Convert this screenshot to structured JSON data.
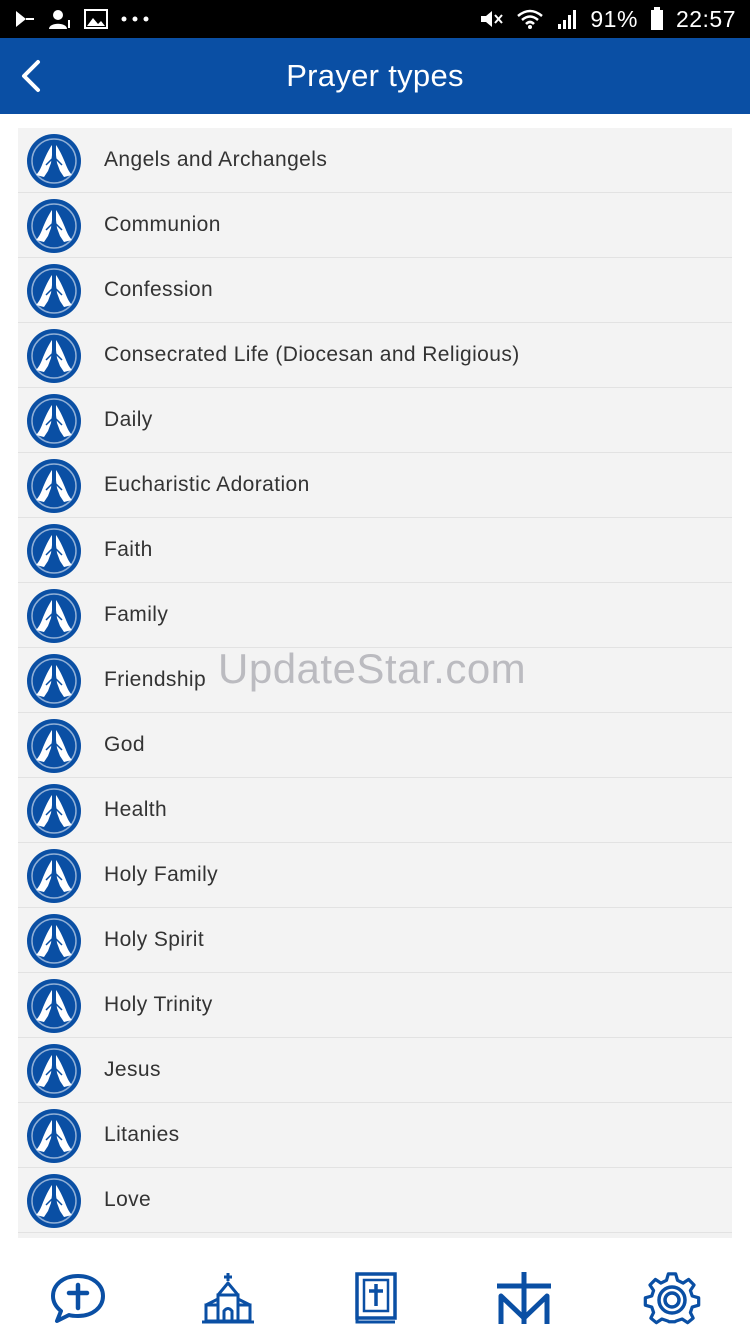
{
  "status_bar": {
    "battery": "91%",
    "time": "22:57",
    "icons": [
      "play-store-icon",
      "person-icon",
      "image-icon",
      "more-icon",
      "mute-icon",
      "wifi-icon",
      "signal-icon",
      "battery-icon"
    ]
  },
  "header": {
    "title": "Prayer types",
    "back_icon": "back-arrow-icon",
    "color": "#0a4fa4"
  },
  "list": {
    "icon": "praying-hands-icon",
    "items": [
      {
        "label": "Angels and Archangels"
      },
      {
        "label": "Communion"
      },
      {
        "label": "Confession"
      },
      {
        "label": "Consecrated Life (Diocesan and Religious)"
      },
      {
        "label": "Daily"
      },
      {
        "label": "Eucharistic Adoration"
      },
      {
        "label": "Faith"
      },
      {
        "label": "Family"
      },
      {
        "label": "Friendship"
      },
      {
        "label": "God"
      },
      {
        "label": "Health"
      },
      {
        "label": "Holy Family"
      },
      {
        "label": "Holy Spirit"
      },
      {
        "label": "Holy Trinity"
      },
      {
        "label": "Jesus"
      },
      {
        "label": "Litanies"
      },
      {
        "label": "Love"
      }
    ]
  },
  "watermark": "UpdateStar.com",
  "bottom_nav": {
    "items": [
      {
        "icon": "prayer-bubble-icon"
      },
      {
        "icon": "church-icon"
      },
      {
        "icon": "bible-icon"
      },
      {
        "icon": "cross-monogram-icon"
      },
      {
        "icon": "settings-gear-icon"
      }
    ],
    "color": "#0a4fa4"
  }
}
